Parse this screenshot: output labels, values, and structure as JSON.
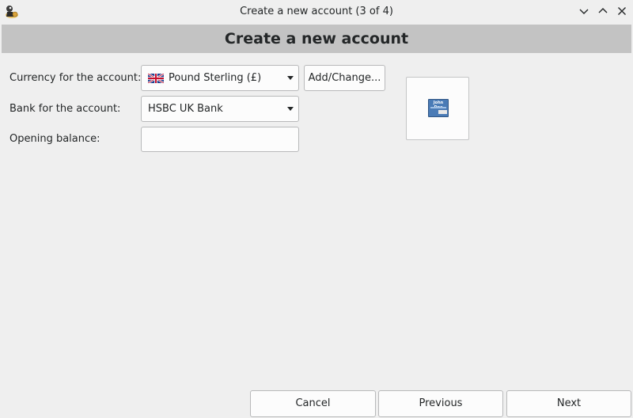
{
  "window": {
    "title": "Create a new account (3 of 4)",
    "icons": {
      "app": "kmymoney-app-icon",
      "minimize": "chevron-down-icon",
      "maximize": "chevron-up-icon",
      "close": "close-icon"
    }
  },
  "banner": {
    "title": "Create a new account"
  },
  "form": {
    "currency": {
      "label": "Currency for the account:",
      "value": "Pound Sterling (£)",
      "flag": "uk-flag-icon"
    },
    "add_change_label": "Add/Change...",
    "bank": {
      "label": "Bank for the account:",
      "value": "HSBC UK Bank"
    },
    "opening_balance": {
      "label": "Opening balance:",
      "value": "",
      "placeholder": ""
    }
  },
  "account_icon": {
    "card_text": "John Doe",
    "icon": "bank-card-icon"
  },
  "footer": {
    "cancel_label": "Cancel",
    "previous_label": "Previous",
    "next_label": "Next"
  },
  "colors": {
    "window_bg": "#efefef",
    "banner_bg": "#c3c3c3",
    "field_bg": "#fcfcfc",
    "border": "#b8b9ba",
    "card": "#4a7bb6"
  }
}
